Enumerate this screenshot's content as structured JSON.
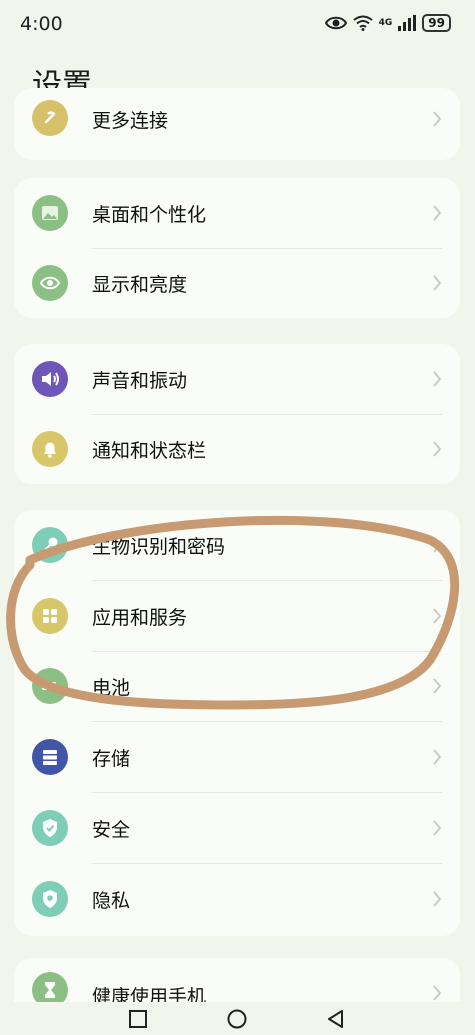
{
  "status_bar": {
    "time": "4:00",
    "battery": "99",
    "network": "4G",
    "icons": [
      "eye-icon",
      "wifi-icon",
      "signal-icon",
      "battery-icon"
    ]
  },
  "page": {
    "title": "设置"
  },
  "groups": [
    {
      "items": [
        {
          "label": "更多连接",
          "icon": "link-icon",
          "color": "#d6c16a"
        }
      ]
    },
    {
      "items": [
        {
          "label": "桌面和个性化",
          "icon": "wallpaper-icon",
          "color": "#8cbf84"
        },
        {
          "label": "显示和亮度",
          "icon": "eye-icon",
          "color": "#8cbf84"
        }
      ]
    },
    {
      "items": [
        {
          "label": "声音和振动",
          "icon": "speaker-icon",
          "color": "#6e55b8"
        },
        {
          "label": "通知和状态栏",
          "icon": "bell-icon",
          "color": "#d8c66a"
        }
      ]
    },
    {
      "items": [
        {
          "label": "生物识别和密码",
          "icon": "key-icon",
          "color": "#7ecdb7"
        },
        {
          "label": "应用和服务",
          "icon": "apps-icon",
          "color": "#d8c66a"
        },
        {
          "label": "电池",
          "icon": "battery-icon",
          "color": "#8cbf84"
        },
        {
          "label": "存储",
          "icon": "storage-icon",
          "color": "#4156a8"
        },
        {
          "label": "安全",
          "icon": "shield-check-icon",
          "color": "#7ecdb7"
        },
        {
          "label": "隐私",
          "icon": "privacy-icon",
          "color": "#7ecdb7"
        }
      ]
    },
    {
      "items": [
        {
          "label": "健康使用手机",
          "icon": "hourglass-icon",
          "color": "#8cbf84"
        }
      ]
    }
  ],
  "annotation": {
    "shape": "hand-drawn-ellipse",
    "color": "#c79a72",
    "encircles": [
      "生物识别和密码",
      "应用和服务",
      "电池"
    ]
  },
  "nav_bar": {
    "buttons": [
      "recent-apps-button",
      "home-button",
      "back-button"
    ]
  }
}
